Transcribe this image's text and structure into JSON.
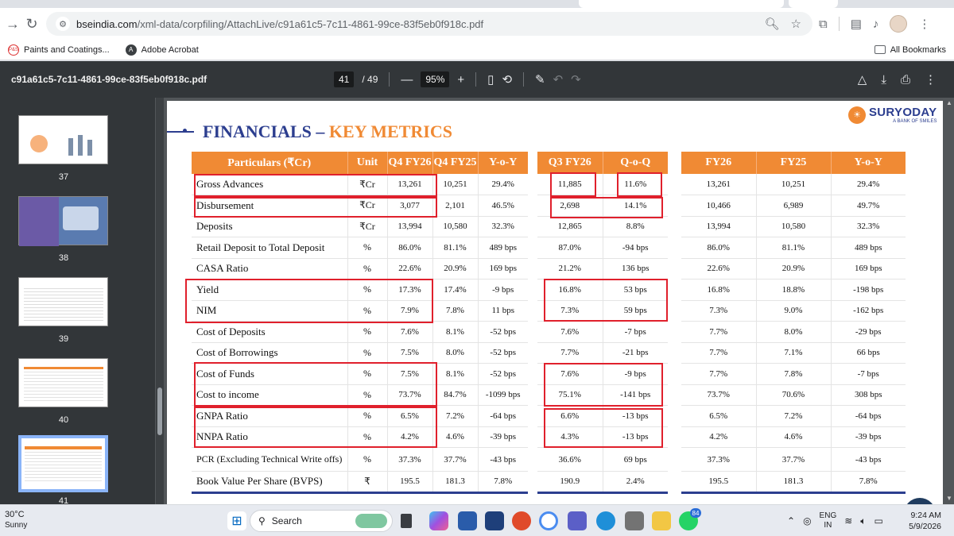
{
  "browser": {
    "url_domain": "bseindia.com",
    "url_path": "/xml-data/corpfiling/AttachLive/c91a61c5-7c11-4861-99ce-83f5eb0f918c.pdf",
    "bookmarks": [
      {
        "label": "Paints and Coatings...",
        "icon_text": "P&S"
      },
      {
        "label": "Adobe Acrobat",
        "icon_text": "A"
      }
    ],
    "all_bookmarks_label": "All Bookmarks"
  },
  "pdf_viewer": {
    "file_name": "c91a61c5-7c11-4861-99ce-83f5eb0f918c.pdf",
    "current_page": "41",
    "total_pages": "/ 49",
    "zoom": "95%",
    "zoom_out": "—",
    "zoom_in": "+",
    "thumbnails": [
      {
        "page": "37"
      },
      {
        "page": "38"
      },
      {
        "page": "39"
      },
      {
        "page": "40"
      },
      {
        "page": "41"
      }
    ]
  },
  "slide": {
    "title_main": "FINANCIALS – ",
    "title_accent": "KEY METRICS",
    "logo_name": "SURYODAY",
    "logo_tagline": "A BANK OF SMILES",
    "quarter_table": {
      "headers": [
        "Particulars (₹Cr)",
        "Unit",
        "Q4 FY26",
        "Q4 FY25",
        "Y-o-Y"
      ],
      "rows": [
        [
          "Gross Advances",
          "₹Cr",
          "13,261",
          "10,251",
          "29.4%"
        ],
        [
          "Disbursement",
          "₹Cr",
          "3,077",
          "2,101",
          "46.5%"
        ],
        [
          "Deposits",
          "₹Cr",
          "13,994",
          "10,580",
          "32.3%"
        ],
        [
          "Retail Deposit to Total Deposit",
          "%",
          "86.0%",
          "81.1%",
          "489 bps"
        ],
        [
          "CASA Ratio",
          "%",
          "22.6%",
          "20.9%",
          "169 bps"
        ],
        [
          "Yield",
          "%",
          "17.3%",
          "17.4%",
          "-9 bps"
        ],
        [
          "NIM",
          "%",
          "7.9%",
          "7.8%",
          "11 bps"
        ],
        [
          "Cost of Deposits",
          "%",
          "7.6%",
          "8.1%",
          "-52 bps"
        ],
        [
          "Cost of Borrowings",
          "%",
          "7.5%",
          "8.0%",
          "-52 bps"
        ],
        [
          "Cost of Funds",
          "%",
          "7.5%",
          "8.1%",
          "-52 bps"
        ],
        [
          "Cost to income",
          "%",
          "73.7%",
          "84.7%",
          "-1099 bps"
        ],
        [
          "GNPA Ratio",
          "%",
          "6.5%",
          "7.2%",
          "-64 bps"
        ],
        [
          "NNPA Ratio",
          "%",
          "4.2%",
          "4.6%",
          "-39 bps"
        ],
        [
          "PCR (Excluding Technical Write offs)",
          "%",
          "37.3%",
          "37.7%",
          "-43 bps"
        ],
        [
          "Book Value Per Share (BVPS)",
          "₹",
          "195.5",
          "181.3",
          "7.8%"
        ]
      ]
    },
    "qoq_table": {
      "headers": [
        "Q3 FY26",
        "Q-o-Q"
      ],
      "rows": [
        [
          "11,885",
          "11.6%"
        ],
        [
          "2,698",
          "14.1%"
        ],
        [
          "12,865",
          "8.8%"
        ],
        [
          "87.0%",
          "-94 bps"
        ],
        [
          "21.2%",
          "136 bps"
        ],
        [
          "16.8%",
          "53 bps"
        ],
        [
          "7.3%",
          "59 bps"
        ],
        [
          "7.6%",
          "-7 bps"
        ],
        [
          "7.7%",
          "-21 bps"
        ],
        [
          "7.6%",
          "-9 bps"
        ],
        [
          "75.1%",
          "-141 bps"
        ],
        [
          "6.6%",
          "-13 bps"
        ],
        [
          "4.3%",
          "-13 bps"
        ],
        [
          "36.6%",
          "69 bps"
        ],
        [
          "190.9",
          "2.4%"
        ]
      ]
    },
    "fy_table": {
      "headers": [
        "FY26",
        "FY25",
        "Y-o-Y"
      ],
      "rows": [
        [
          "13,261",
          "10,251",
          "29.4%"
        ],
        [
          "10,466",
          "6,989",
          "49.7%"
        ],
        [
          "13,994",
          "10,580",
          "32.3%"
        ],
        [
          "86.0%",
          "81.1%",
          "489 bps"
        ],
        [
          "22.6%",
          "20.9%",
          "169 bps"
        ],
        [
          "16.8%",
          "18.8%",
          "-198 bps"
        ],
        [
          "7.3%",
          "9.0%",
          "-162 bps"
        ],
        [
          "7.7%",
          "8.0%",
          "-29 bps"
        ],
        [
          "7.7%",
          "7.1%",
          "66 bps"
        ],
        [
          "7.7%",
          "7.8%",
          "-7 bps"
        ],
        [
          "73.7%",
          "70.6%",
          "308 bps"
        ],
        [
          "6.5%",
          "7.2%",
          "-64 bps"
        ],
        [
          "4.2%",
          "4.6%",
          "-39 bps"
        ],
        [
          "37.3%",
          "37.7%",
          "-43 bps"
        ],
        [
          "195.5",
          "181.3",
          "7.8%"
        ]
      ]
    }
  },
  "taskbar": {
    "temperature": "30°C",
    "weather": "Sunny",
    "search_placeholder": "Search",
    "lang_1": "ENG",
    "lang_2": "IN",
    "time": "9:24 AM",
    "date": "5/9/2026",
    "whatsapp_badge": "84"
  },
  "colors": {
    "accent_orange": "#f08a34",
    "navy": "#2c3e8f",
    "highlight_red": "#e0202c"
  }
}
